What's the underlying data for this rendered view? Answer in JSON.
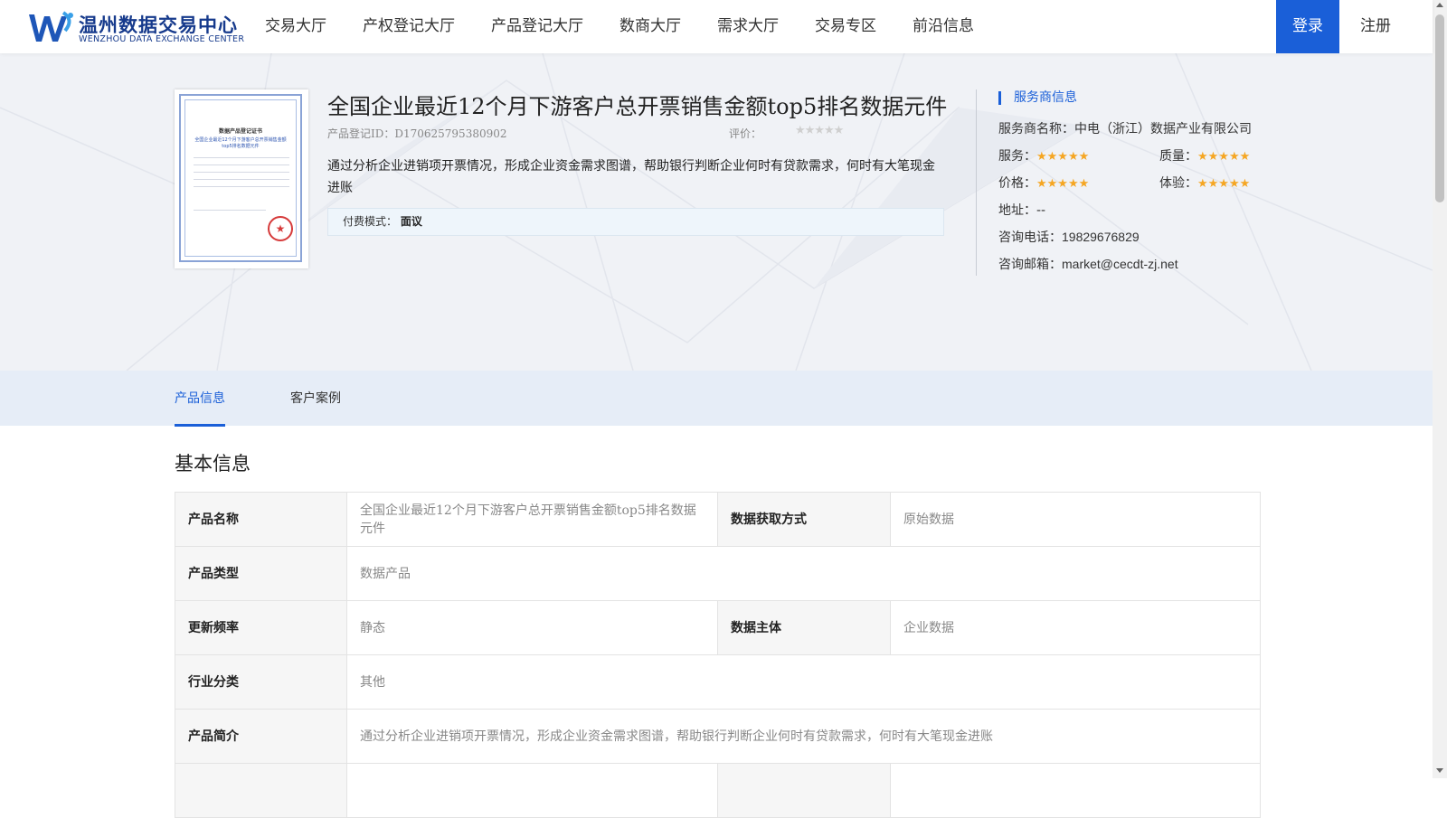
{
  "header": {
    "logo_cn": "温州数据交易中心",
    "logo_en": "WENZHOU DATA EXCHANGE CENTER",
    "nav": [
      "交易大厅",
      "产权登记大厅",
      "产品登记大厅",
      "数商大厅",
      "需求大厅",
      "交易专区",
      "前沿信息"
    ],
    "login": "登录",
    "register": "注册"
  },
  "product": {
    "title": "全国企业最近12个月下游客户总开票销售金额top5排名数据元件",
    "id_label": "产品登记ID：D170625795380902",
    "rating_label": "评价：",
    "rating_stars": "★★★★★",
    "description": "通过分析企业进销项开票情况，形成企业资金需求图谱，帮助银行判断企业何时有贷款需求，何时有大笔现金进账",
    "pay_label": "付费模式：",
    "pay_value": "面议"
  },
  "certificate": {
    "title": "数据产品登记证书",
    "subtitle": "全国企业最近12个月下游客户总开票销售金额top5排名数据元件"
  },
  "service_provider": {
    "section_title": "服务商信息",
    "name_label": "服务商名称：",
    "name_value": "中电（浙江）数据产业有限公司",
    "service_label": "服务：",
    "quality_label": "质量：",
    "price_label": "价格：",
    "experience_label": "体验：",
    "stars": "★★★★★",
    "address_label": "地址：",
    "address_value": "--",
    "phone_label": "咨询电话：",
    "phone_value": "19829676829",
    "email_label": "咨询邮箱：",
    "email_value": "market@cecdt-zj.net"
  },
  "tabs": [
    "产品信息",
    "客户案例"
  ],
  "basic_info": {
    "title": "基本信息",
    "product_name_label": "产品名称",
    "product_name_value": "全国企业最近12个月下游客户总开票销售金额top5排名数据元件",
    "acquisition_label": "数据获取方式",
    "acquisition_value": "原始数据",
    "type_label": "产品类型",
    "type_value": "数据产品",
    "frequency_label": "更新频率",
    "frequency_value": "静态",
    "subject_label": "数据主体",
    "subject_value": "企业数据",
    "industry_label": "行业分类",
    "industry_value": "其他",
    "intro_label": "产品简介",
    "intro_value": "通过分析企业进销项开票情况，形成企业资金需求图谱，帮助银行判断企业何时有贷款需求，何时有大笔现金进账"
  },
  "colors": {
    "primary": "#1a5fd8",
    "star": "#f5a623",
    "hero_bg": "#f0f2f6",
    "tab_bg": "#e6edf7"
  }
}
